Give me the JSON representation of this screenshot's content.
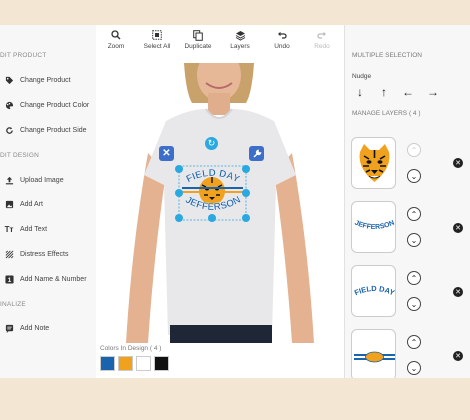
{
  "sidebar": {
    "sections": [
      {
        "title": "DIT PRODUCT"
      },
      {
        "title": "DIT DESIGN"
      },
      {
        "title": "INALIZE"
      }
    ],
    "items": [
      {
        "label": "Change Product",
        "icon": "tag-icon"
      },
      {
        "label": "Change Product Color",
        "icon": "palette-icon"
      },
      {
        "label": "Change Product Side",
        "icon": "rotate-icon"
      },
      {
        "label": "Upload Image",
        "icon": "upload-icon"
      },
      {
        "label": "Add Art",
        "icon": "image-icon"
      },
      {
        "label": "Add Text",
        "icon": "text-icon"
      },
      {
        "label": "Distress Effects",
        "icon": "distress-icon"
      },
      {
        "label": "Add Name & Number",
        "icon": "number-icon"
      },
      {
        "label": "Add Note",
        "icon": "note-icon"
      }
    ]
  },
  "toolbar": {
    "buttons": [
      {
        "label": "Zoom",
        "icon": "zoom-icon",
        "enabled": true
      },
      {
        "label": "Select All",
        "icon": "select-all-icon",
        "enabled": true
      },
      {
        "label": "Duplicate",
        "icon": "duplicate-icon",
        "enabled": true
      },
      {
        "label": "Layers",
        "icon": "layers-icon",
        "enabled": true
      },
      {
        "label": "Undo",
        "icon": "undo-icon",
        "enabled": true
      },
      {
        "label": "Redo",
        "icon": "redo-icon",
        "enabled": false
      }
    ]
  },
  "canvas": {
    "design_text_top": "FIELD DAY",
    "design_text_bottom": "JEFFERSON"
  },
  "colors": {
    "label": "Colors In Design ( 4 )",
    "swatches": [
      "#1a63ad",
      "#f0a21e",
      "#ffffff",
      "#111111"
    ]
  },
  "right_panel": {
    "title": "MULTIPLE SELECTION",
    "nudge_label": "Nudge",
    "manage_layers_label": "MANAGE LAYERS ( 4 )",
    "layers": [
      {
        "name": "tiger",
        "up_enabled": false
      },
      {
        "name": "JEFFERSON",
        "up_enabled": true
      },
      {
        "name": "FIELD DAY",
        "up_enabled": true
      },
      {
        "name": "banner",
        "up_enabled": true
      }
    ]
  },
  "theme": {
    "accent": "#2aa8e0",
    "handle_dark": "#3b6fc9",
    "blue": "#1a63ad",
    "orange": "#f0a21e"
  }
}
